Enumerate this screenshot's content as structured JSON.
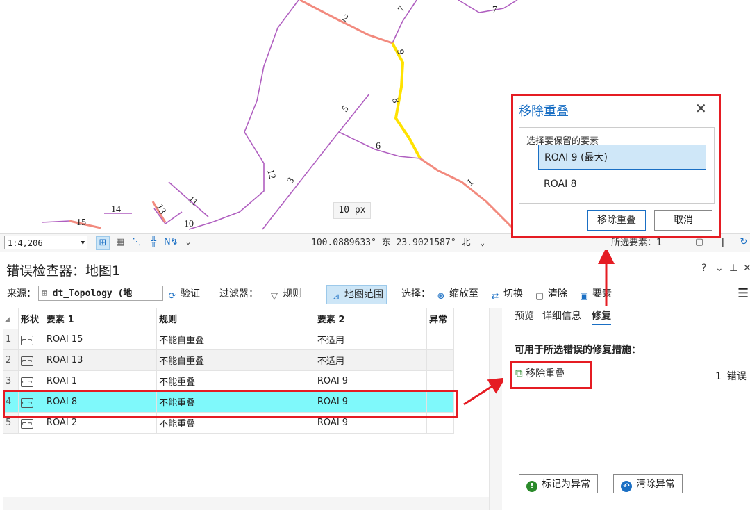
{
  "map": {
    "scale_label": "10 px",
    "features": [
      {
        "id": "15",
        "label": "15"
      },
      {
        "id": "14",
        "label": "14"
      },
      {
        "id": "13",
        "label": "13"
      },
      {
        "id": "12",
        "label": "12"
      },
      {
        "id": "11",
        "label": "11"
      },
      {
        "id": "10",
        "label": "10"
      },
      {
        "id": "9",
        "label": "9"
      },
      {
        "id": "8",
        "label": "8"
      },
      {
        "id": "7a",
        "label": "7"
      },
      {
        "id": "7b",
        "label": "7"
      },
      {
        "id": "6",
        "label": "6"
      },
      {
        "id": "5",
        "label": "5"
      },
      {
        "id": "3",
        "label": "3"
      },
      {
        "id": "2",
        "label": "2"
      },
      {
        "id": "1",
        "label": "1"
      }
    ],
    "colors": {
      "normal": "#b05fc0",
      "error": "#f28a7e",
      "selected": "#ffe200"
    }
  },
  "statusbar": {
    "scale": "1:4,206",
    "coords": "100.0889633° 东 23.9021587° 北",
    "selected_features": "所选要素：1"
  },
  "pane": {
    "title": "错误检查器：地图1",
    "controls": [
      "?",
      "⌄",
      "⊥",
      "✕"
    ]
  },
  "toolbar": {
    "source_label": "来源：",
    "source_value": "dt_Topology (地",
    "validate": "验证",
    "filter_label": "过滤器：",
    "rules": "规则",
    "map_extent": "地图范围",
    "select_label": "选择：",
    "zoom_to": "缩放至",
    "switch": "切换",
    "clear": "清除",
    "features": "要素"
  },
  "table": {
    "headers": {
      "shape": "形状",
      "feature1": "要素 1",
      "rule": "规则",
      "feature2": "要素 2",
      "exception": "异常"
    },
    "rows": [
      {
        "n": "1",
        "f1": "ROAI 15",
        "rule": "不能自重叠",
        "f2": "不适用"
      },
      {
        "n": "2",
        "f1": "ROAI 13",
        "rule": "不能自重叠",
        "f2": "不适用"
      },
      {
        "n": "3",
        "f1": "ROAI 1",
        "rule": "不能重叠",
        "f2": "ROAI 9"
      },
      {
        "n": "4",
        "f1": "ROAI 8",
        "rule": "不能重叠",
        "f2": "ROAI 9"
      },
      {
        "n": "5",
        "f1": "ROAI 2",
        "rule": "不能重叠",
        "f2": "ROAI 9"
      }
    ]
  },
  "rightpanel": {
    "tabs": [
      "预览",
      "详细信息",
      "修复"
    ],
    "heading": "可用于所选错误的修复措施：",
    "fix_action": "移除重叠",
    "fix_count": "1 错误",
    "mark_exception": "标记为异常",
    "clear_exception": "清除异常"
  },
  "dialog": {
    "title": "移除重叠",
    "group_label": "选择要保留的要素",
    "options": [
      "ROAI 9 (最大)",
      "ROAI 8"
    ],
    "ok": "移除重叠",
    "cancel": "取消"
  },
  "accent": "#1a6fc4",
  "highlight_red": "#e51c23"
}
